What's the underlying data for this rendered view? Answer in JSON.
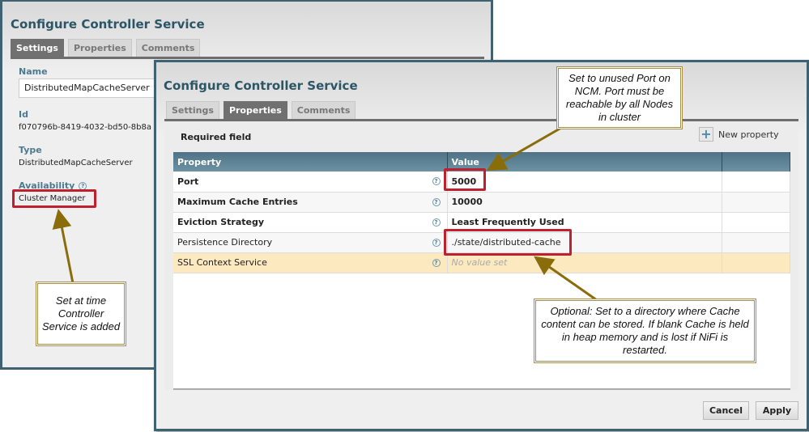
{
  "background_dialog": {
    "title": "Configure Controller Service",
    "tabs": [
      {
        "label": "Settings",
        "active": true
      },
      {
        "label": "Properties",
        "active": false
      },
      {
        "label": "Comments",
        "active": false
      }
    ],
    "name_label": "Name",
    "name_value": "DistributedMapCacheServer",
    "id_label": "Id",
    "id_value": "f070796b-8419-4032-bd50-8b8a",
    "type_label": "Type",
    "type_value": "DistributedMapCacheServer",
    "availability_label": "Availability",
    "availability_value": "Cluster Manager"
  },
  "front_dialog": {
    "title": "Configure Controller Service",
    "tabs": [
      {
        "label": "Settings",
        "active": false
      },
      {
        "label": "Properties",
        "active": true
      },
      {
        "label": "Comments",
        "active": false
      }
    ],
    "required_label": "Required field",
    "new_property_label": "New property",
    "columns": [
      "Property",
      "Value",
      ""
    ],
    "rows": [
      {
        "property": "Port",
        "value": "5000",
        "required": true
      },
      {
        "property": "Maximum Cache Entries",
        "value": "10000",
        "required": true
      },
      {
        "property": "Eviction Strategy",
        "value": "Least Frequently Used",
        "required": true
      },
      {
        "property": "Persistence Directory",
        "value": "./state/distributed-cache",
        "required": false
      },
      {
        "property": "SSL Context Service",
        "value": "No value set",
        "required": false
      }
    ],
    "cancel_label": "Cancel",
    "apply_label": "Apply"
  },
  "annotations": {
    "port_note": "Set to unused Port on NCM. Port must be reachable by all Nodes in cluster",
    "availability_note": "Set at time Controller Service is added",
    "persistence_note": "Optional: Set to a directory where Cache content can be stored.  If blank Cache is held in heap memory and is lost  if NiFi is restarted."
  },
  "colors": {
    "accent": "#2c5566",
    "highlight_box": "#c0202e",
    "arrow": "#8a6d0b",
    "callout_border": "#a88e4a"
  }
}
